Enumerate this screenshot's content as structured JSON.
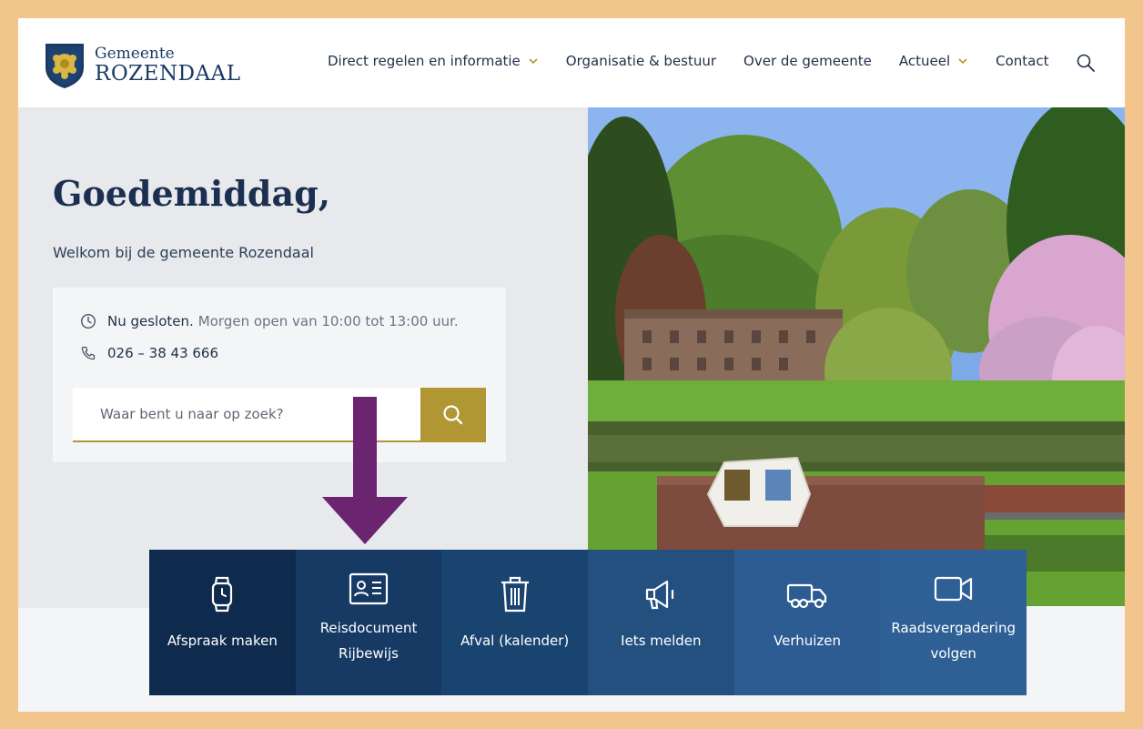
{
  "header": {
    "logo_line1": "Gemeente",
    "logo_line2": "ROZENDAAL",
    "nav": [
      {
        "label": "Direct regelen en informatie",
        "dropdown": true
      },
      {
        "label": "Organisatie & bestuur",
        "dropdown": false
      },
      {
        "label": "Over de gemeente",
        "dropdown": false
      },
      {
        "label": "Actueel",
        "dropdown": true
      },
      {
        "label": "Contact",
        "dropdown": false
      }
    ]
  },
  "hero": {
    "greeting": "Goedemiddag,",
    "welcome": "Welkom bij de gemeente Rozendaal",
    "status_strong": "Nu gesloten.",
    "status_rest": "Morgen open van 10:00 tot 13:00 uur.",
    "phone": "026 – 38 43 666",
    "search_placeholder": "Waar bent u naar op zoek?"
  },
  "tiles": [
    {
      "label": "Afspraak maken",
      "icon": "watch-icon",
      "bg": "#0e2a4d"
    },
    {
      "label": "Reisdocument\nRijbewijs",
      "icon": "id-card-icon",
      "bg": "#163a64"
    },
    {
      "label": "Afval (kalender)",
      "icon": "trash-icon",
      "bg": "#1a4470"
    },
    {
      "label": "Iets melden",
      "icon": "megaphone-icon",
      "bg": "#245080"
    },
    {
      "label": "Verhuizen",
      "icon": "truck-icon",
      "bg": "#2c5c91"
    },
    {
      "label": "Raadsvergadering\nvolgen",
      "icon": "video-camera-icon",
      "bg": "#2e6096"
    }
  ],
  "colors": {
    "accent_gold": "#b19634",
    "navy": "#1b3050",
    "arrow_purple": "#6b2470",
    "frame_border": "#f2c58d"
  }
}
